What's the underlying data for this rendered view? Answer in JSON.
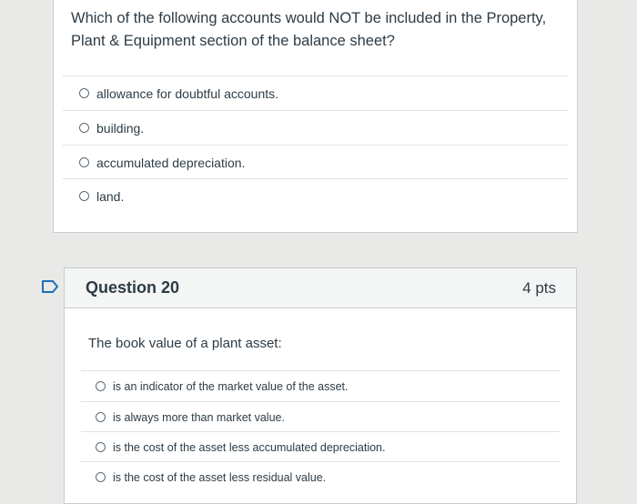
{
  "question19": {
    "text": "Which of the following accounts would NOT be included in the Property, Plant & Equipment section of the balance sheet?",
    "answers": [
      "allowance for doubtful accounts.",
      "building.",
      "accumulated depreciation.",
      "land."
    ]
  },
  "question20": {
    "title": "Question 20",
    "points": "4 pts",
    "text": "The book value of a plant asset:",
    "answers": [
      "is an indicator of the market value of the asset.",
      "is always more than market value.",
      "is the cost of the asset less accumulated depreciation.",
      "is the cost of the asset less residual value."
    ]
  },
  "colors": {
    "accent": "#2d3b45",
    "flag": "#1d6fb8"
  },
  "icons": {
    "flag": "flag-question-icon",
    "radio": "radio-unselected-icon"
  }
}
